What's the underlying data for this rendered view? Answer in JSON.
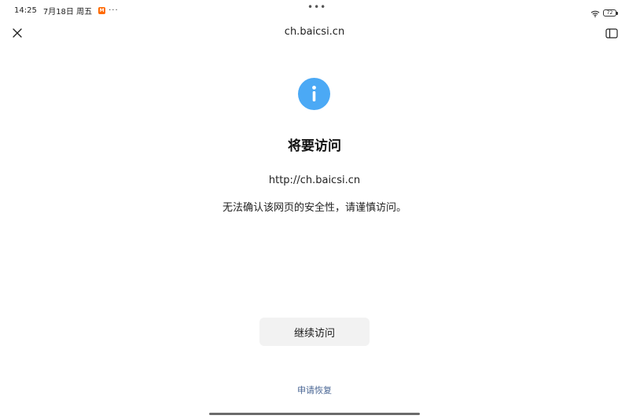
{
  "status_bar": {
    "time": "14:25",
    "date": "7月18日 周五",
    "app_badge": "M",
    "more": "···",
    "center_dots": "•••",
    "battery_level": "72"
  },
  "nav": {
    "title": "ch.baicsi.cn"
  },
  "main": {
    "heading": "将要访问",
    "url": "http://ch.baicsi.cn",
    "warning": "无法确认该网页的安全性，请谨慎访问。",
    "continue_label": "继续访问",
    "appeal_label": "申请恢复"
  },
  "icons": {
    "close": "close-icon",
    "sidebar": "sidebar-toggle-icon",
    "info": "info-icon",
    "wifi": "wifi-icon",
    "battery": "battery-icon"
  },
  "colors": {
    "info_blue": "#4ba9f5",
    "button_bg": "#f2f2f2",
    "link": "#4a6694"
  }
}
